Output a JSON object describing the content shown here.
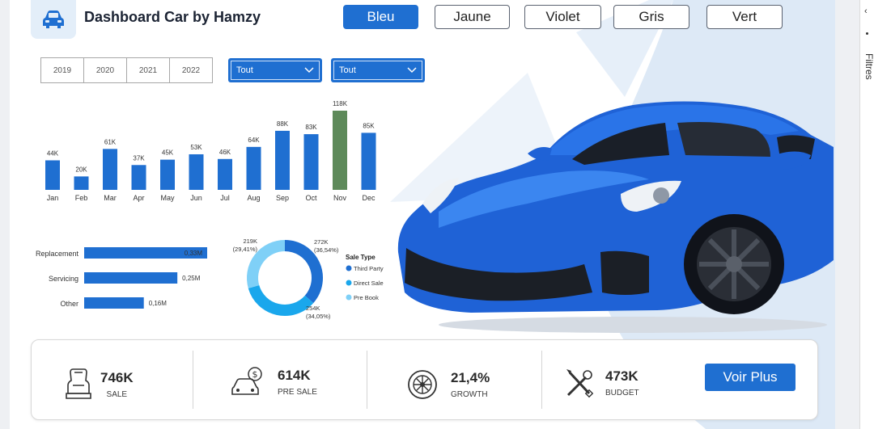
{
  "header": {
    "title": "Dashboard Car by Hamzy",
    "icon": "car-icon"
  },
  "themes": [
    "Bleu",
    "Jaune",
    "Violet",
    "Gris",
    "Vert"
  ],
  "active_theme": "Bleu",
  "years": [
    "2019",
    "2020",
    "2021",
    "2022"
  ],
  "dropdowns": [
    {
      "value": "Tout"
    },
    {
      "value": "Tout"
    }
  ],
  "colors": {
    "accent": "#1f6fd1",
    "highlight": "#5e8a5a",
    "third_party": "#1f6fd1",
    "direct_sale": "#1aa7ec",
    "pre_book": "#7fd0f7"
  },
  "chart_data": [
    {
      "type": "bar",
      "categories": [
        "Jan",
        "Feb",
        "Mar",
        "Apr",
        "May",
        "Jun",
        "Jul",
        "Aug",
        "Sep",
        "Oct",
        "Nov",
        "Dec"
      ],
      "values": [
        44,
        20,
        61,
        37,
        45,
        53,
        46,
        64,
        88,
        83,
        118,
        85
      ],
      "data_labels": [
        "44K",
        "20K",
        "61K",
        "37K",
        "45K",
        "53K",
        "46K",
        "64K",
        "88K",
        "83K",
        "118K",
        "85K"
      ],
      "highlight_category": "Nov"
    },
    {
      "type": "bar",
      "orientation": "horizontal",
      "categories": [
        "Replacement",
        "Servicing",
        "Other"
      ],
      "values": [
        0.33,
        0.25,
        0.16
      ],
      "data_labels": [
        "0,33M",
        "0,25M",
        "0,16M"
      ]
    },
    {
      "type": "pie",
      "variant": "donut",
      "legend_title": "Sale Type",
      "legend_placement": "right",
      "slices": [
        {
          "name": "Third Party",
          "value": 272,
          "label": "272K",
          "pct": "(36,54%)"
        },
        {
          "name": "Direct Sale",
          "value": 254,
          "label": "254K",
          "pct": "(34,05%)"
        },
        {
          "name": "Pre Book",
          "value": 219,
          "label": "219K",
          "pct": "(29,41%)"
        }
      ]
    }
  ],
  "kpis": [
    {
      "value": "746K",
      "label": "SALE",
      "icon": "car-seat-icon"
    },
    {
      "value": "614K",
      "label": "PRE SALE",
      "icon": "car-dollar-icon"
    },
    {
      "value": "21,4%",
      "label": "GROWTH",
      "icon": "wheel-icon"
    },
    {
      "value": "473K",
      "label": "BUDGET",
      "icon": "tools-icon"
    }
  ],
  "more_button": "Voir Plus",
  "side_panel": {
    "label": "Filtres"
  }
}
